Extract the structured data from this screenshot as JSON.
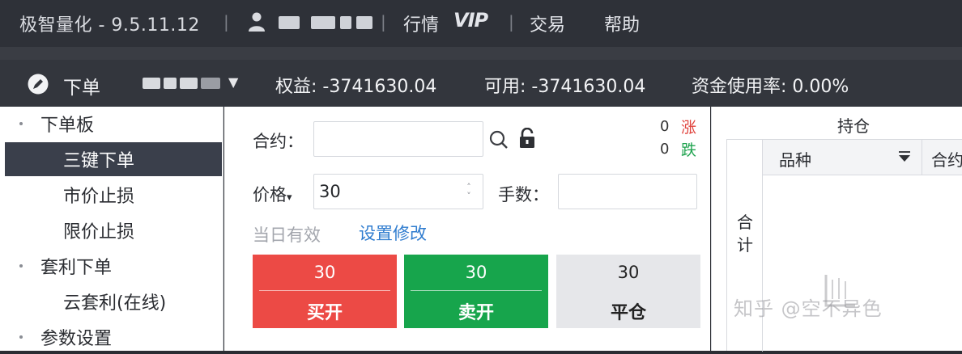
{
  "titlebar": {
    "app_title": "极智量化 - 9.5.11.12",
    "sep": "|",
    "menu_market": "行情",
    "vip": "VIP",
    "menu_trade": "交易",
    "menu_help": "帮助"
  },
  "toolbar": {
    "order_title": "下单",
    "caret": "▼",
    "equity": "权益: -3741630.04",
    "available": "可用: -3741630.04",
    "usage": "资金使用率: 0.00%"
  },
  "sidebar": {
    "items": [
      {
        "label": "下单板",
        "bullet": true
      },
      {
        "label": "三键下单",
        "bullet": false,
        "active": true
      },
      {
        "label": "市价止损",
        "bullet": false
      },
      {
        "label": "限价止损",
        "bullet": false
      },
      {
        "label": "套利下单",
        "bullet": true
      },
      {
        "label": "云套利(在线)",
        "bullet": false
      },
      {
        "label": "参数设置",
        "bullet": true
      }
    ]
  },
  "form": {
    "contract_label": "合约：",
    "contract_value": "",
    "up_count": "0",
    "up_label": "涨",
    "down_count": "0",
    "down_label": "跌",
    "price_label": "价格",
    "price_caret": "▾",
    "price_value": "30",
    "qty_label": "手数：",
    "qty_value": "",
    "validity": "当日有效",
    "settings_link": "设置修改",
    "buy_price": "30",
    "buy_label": "买开",
    "sell_price": "30",
    "sell_label": "卖开",
    "close_price": "30",
    "close_label": "平仓"
  },
  "positions": {
    "title": "持仓",
    "total_label": "合计",
    "col_symbol": "品种",
    "col_next": "合约"
  },
  "watermark": "知乎 @空不异色",
  "colors": {
    "buy": "#ec4a45",
    "sell": "#17a54c",
    "link": "#2f7ccf",
    "up": "#e0433d",
    "down": "#1fa34f"
  }
}
